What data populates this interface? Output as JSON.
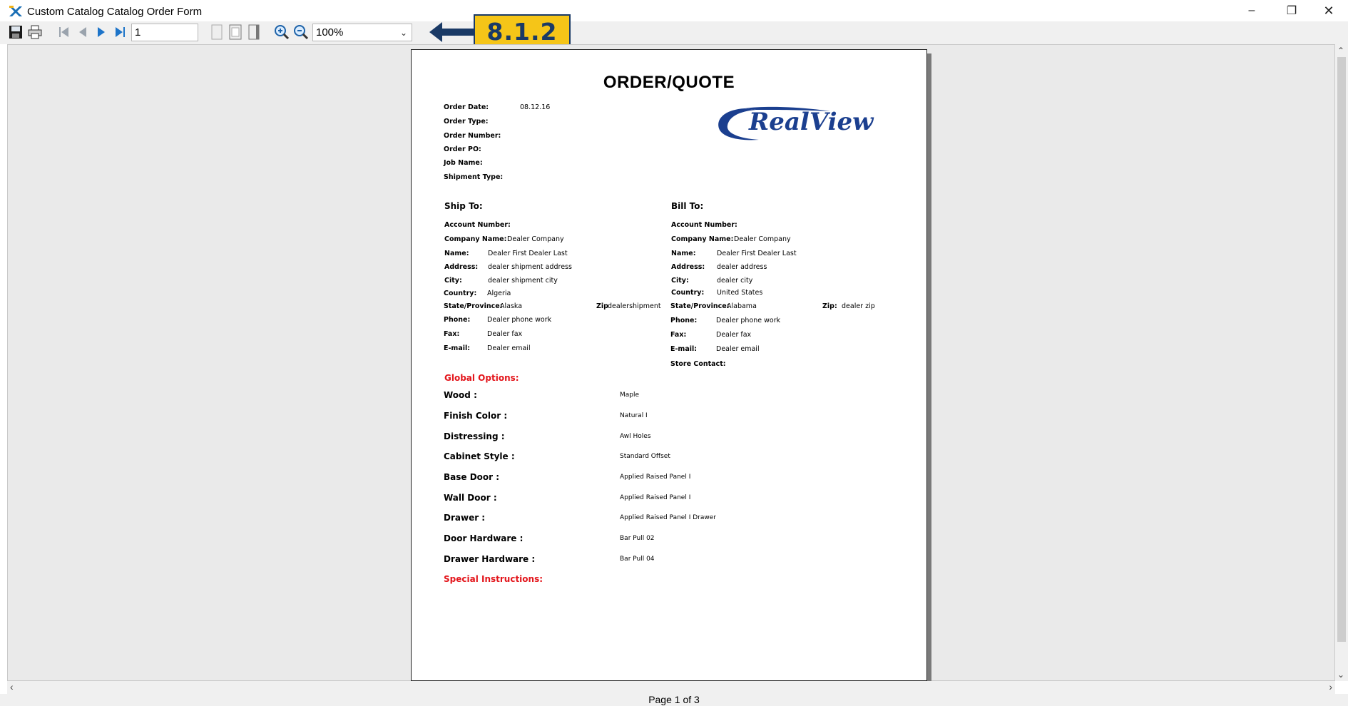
{
  "window": {
    "title": "Custom Catalog Catalog Order Form",
    "minimize": "–",
    "restore": "❐",
    "close": "✕"
  },
  "toolbar": {
    "page_number": "1",
    "zoom": "100%"
  },
  "callout": {
    "label": "8.1.2",
    "color": "#f5c518",
    "border_color": "#1a3a66"
  },
  "document": {
    "title": "ORDER/QUOTE",
    "logo_text": "RealView",
    "order_info": [
      {
        "label": "Order Date:",
        "value": "08.12.16"
      },
      {
        "label": "Order Type:",
        "value": ""
      },
      {
        "label": "Order Number:",
        "value": ""
      },
      {
        "label": "Order PO:",
        "value": ""
      },
      {
        "label": "Job Name:",
        "value": ""
      },
      {
        "label": "Shipment Type:",
        "value": ""
      }
    ],
    "ship_to": {
      "heading": "Ship To:",
      "account_number_label": "Account Number:",
      "company_label": "Company Name:",
      "company": "Dealer Company",
      "name_label": "Name:",
      "name": "Dealer First Dealer Last",
      "address_label": "Address:",
      "address": "dealer shipment address",
      "city_label": "City:",
      "city": "dealer shipment city",
      "country_label": "Country:",
      "country": "Algeria",
      "state_label": "State/Province:",
      "state": "Alaska",
      "zip_label": "Zip",
      "zip": "dealershipment",
      "phone_label": "Phone:",
      "phone": "Dealer phone work",
      "fax_label": "Fax:",
      "fax": "Dealer fax",
      "email_label": "E-mail:",
      "email": "Dealer email"
    },
    "bill_to": {
      "heading": "Bill To:",
      "account_number_label": "Account Number:",
      "company_label": "Company Name:",
      "company": "Dealer Company",
      "name_label": "Name:",
      "name": "Dealer First Dealer Last",
      "address_label": "Address:",
      "address": "dealer address",
      "city_label": "City:",
      "city": "dealer city",
      "country_label": "Country:",
      "country": "United States",
      "state_label": "State/Province:",
      "state": "Alabama",
      "zip_label": "Zip:",
      "zip": "dealer zip",
      "phone_label": "Phone:",
      "phone": "Dealer phone work",
      "fax_label": "Fax:",
      "fax": "Dealer fax",
      "email_label": "E-mail:",
      "email": "Dealer email",
      "store_contact_label": "Store Contact:"
    },
    "global_options_heading": "Global Options:",
    "global_options": [
      {
        "label": "Wood :",
        "value": "Maple"
      },
      {
        "label": "Finish Color :",
        "value": "Natural I"
      },
      {
        "label": "Distressing :",
        "value": "Awl Holes"
      },
      {
        "label": "Cabinet Style :",
        "value": "Standard Offset"
      },
      {
        "label": "Base Door :",
        "value": "Applied Raised Panel I"
      },
      {
        "label": "Wall Door :",
        "value": "Applied Raised Panel I"
      },
      {
        "label": "Drawer :",
        "value": "Applied Raised Panel I Drawer"
      },
      {
        "label": "Door Hardware :",
        "value": "Bar Pull 02"
      },
      {
        "label": "Drawer Hardware :",
        "value": "Bar Pull 04"
      }
    ],
    "special_instructions_heading": "Special Instructions:",
    "accent_red": "#e3151b"
  },
  "status": {
    "page_indicator": "Page 1 of 3"
  },
  "icons": {
    "app": "app-icon",
    "save": "save-icon",
    "print": "print-icon",
    "first_page": "first-page-icon",
    "prev_page": "prev-page-icon",
    "next_page": "next-page-icon",
    "last_page": "last-page-icon",
    "single_page": "single-page-icon",
    "multi_page": "multi-page-icon",
    "page_width": "page-width-icon",
    "zoom_in": "zoom-in-icon",
    "zoom_out": "zoom-out-icon"
  }
}
